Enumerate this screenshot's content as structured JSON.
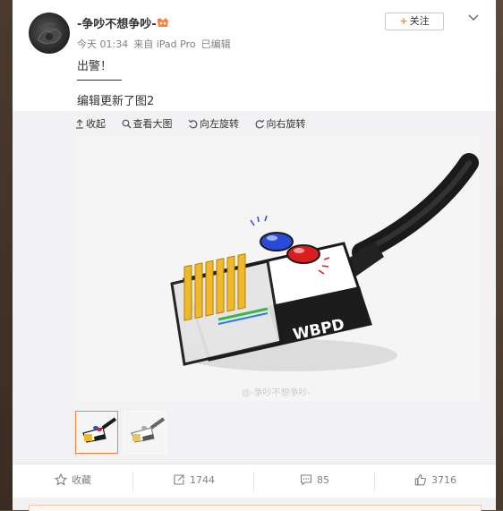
{
  "post": {
    "username": "-争吵不想争吵-",
    "time": "今天 01:34",
    "source": "来自 iPad Pro",
    "edited": "已编辑",
    "follow_label": "关注",
    "text_line1": "出警！",
    "text_line3": "编辑更新了图2"
  },
  "toolbar": {
    "collapse": "收起",
    "view_large": "查看大图",
    "rotate_left": "向左旋转",
    "rotate_right": "向右旋转"
  },
  "image": {
    "badge": "WBPD",
    "watermark": "@-争吵不想争吵-"
  },
  "actions": {
    "favorite": "收藏",
    "repost": "1744",
    "comment": "85",
    "like": "3716"
  },
  "colors": {
    "accent": "#ff8140",
    "text": "#333333",
    "meta": "#808080"
  },
  "icons": [
    "vip-icon",
    "chevron-down-icon",
    "collapse-icon",
    "zoom-icon",
    "rotate-left-icon",
    "rotate-right-icon",
    "star-icon",
    "repost-icon",
    "comment-icon",
    "like-icon"
  ]
}
